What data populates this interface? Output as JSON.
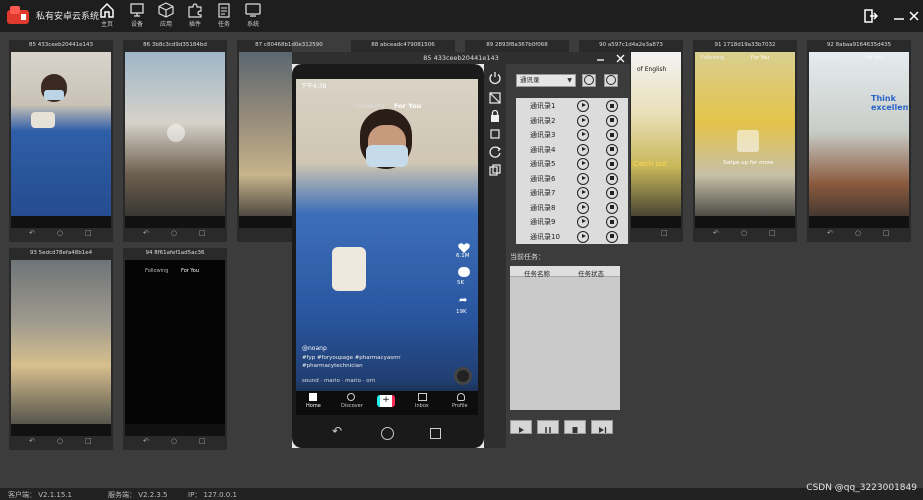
{
  "app": {
    "title": "私有安卓云系统",
    "nav": [
      {
        "label": "主页",
        "icon": "home-icon"
      },
      {
        "label": "设备",
        "icon": "device-icon"
      },
      {
        "label": "应用",
        "icon": "app-cube-icon"
      },
      {
        "label": "插件",
        "icon": "puzzle-icon"
      },
      {
        "label": "任务",
        "icon": "task-list-icon"
      },
      {
        "label": "系统",
        "icon": "monitor-icon"
      }
    ]
  },
  "devices": [
    {
      "title": "85 433ceeb20441e143"
    },
    {
      "title": "86 3b8c3cd9d35184bd"
    },
    {
      "title": "87 c80468b1d0e312590"
    },
    {
      "title": "88 abceadc479081506"
    },
    {
      "title": "89 2893f8a367b0f068"
    },
    {
      "title": "90 a597c1d4a2e3a873"
    },
    {
      "title": "91 1718d19a33b7032"
    },
    {
      "title": "92 8abaa9164635d435"
    },
    {
      "title": "93 5edcd78efa48b1e4"
    },
    {
      "title": "94 8f61afef1ad5ac36"
    }
  ],
  "phone_tabs": {
    "following": "Following",
    "for_you": "For You",
    "home": "Home",
    "discover": "Discover",
    "inbox": "Inbox",
    "profile": "Profile"
  },
  "card_captions": {
    "c1": "Catch out",
    "c2": "Swipe up for more",
    "c3": "Think excellent",
    "c4": "of English"
  },
  "overlay": {
    "title": "85 433ceeb20441e143",
    "status_time": "下午4:38",
    "likes": "6.1M",
    "comments": "5K",
    "shares": "19K",
    "caption_user": "@noanp",
    "caption_tags": "#fyp #foryoupage #pharmacyasmr #pharmacytechnician",
    "sound": "sound · mario · mario · orn",
    "select_value": "通讯录",
    "contacts": [
      "通讯录1",
      "通讯录2",
      "通讯录3",
      "通讯录4",
      "通讯录5",
      "通讯录6",
      "通讯录7",
      "通讯录8",
      "通讯录9",
      "通讯录10"
    ],
    "current_task_label": "当前任务：",
    "task_columns": [
      "任务名称",
      "任务状态"
    ]
  },
  "status": {
    "client": "客户端：  V2.1.15.1",
    "server": "服务端：  V2.2.3.5",
    "ip": "IP：  127.0.0.1"
  },
  "watermark": "CSDN @qq_3223001849"
}
